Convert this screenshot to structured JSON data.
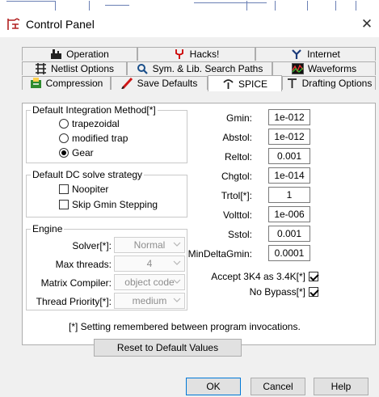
{
  "window": {
    "title": "Control Panel",
    "close_glyph": "✕",
    "title_icon": "app-logo-icon"
  },
  "tabs": {
    "row1": [
      {
        "label": "Operation",
        "icon": "operation-icon"
      },
      {
        "label": "Hacks!",
        "icon": "hacks-icon"
      },
      {
        "label": "Internet",
        "icon": "internet-icon"
      }
    ],
    "row2": [
      {
        "label": "Netlist Options",
        "icon": "netlist-icon"
      },
      {
        "label": "Sym. & Lib. Search Paths",
        "icon": "search-icon"
      },
      {
        "label": "Waveforms",
        "icon": "waveforms-icon"
      }
    ],
    "row3": [
      {
        "label": "Compression",
        "icon": "compression-icon"
      },
      {
        "label": "Save Defaults",
        "icon": "save-defaults-icon"
      },
      {
        "label": "SPICE",
        "icon": "spice-icon",
        "active": true
      },
      {
        "label": "Drafting Options",
        "icon": "drafting-icon"
      }
    ]
  },
  "integration": {
    "legend": "Default Integration Method[*]",
    "options": [
      {
        "label": "trapezoidal",
        "selected": false
      },
      {
        "label": "modified trap",
        "selected": false
      },
      {
        "label": "Gear",
        "selected": true
      }
    ]
  },
  "dc_strategy": {
    "legend": "Default DC solve strategy",
    "options": [
      {
        "label": "Noopiter",
        "checked": false
      },
      {
        "label": "Skip Gmin Stepping",
        "checked": false
      }
    ]
  },
  "engine": {
    "legend": "Engine",
    "solver_label": "Solver[*]:",
    "solver_value": "Normal",
    "threads_label": "Max threads:",
    "threads_value": "4",
    "compiler_label": "Matrix Compiler:",
    "compiler_value": "object code",
    "priority_label": "Thread Priority[*]:",
    "priority_value": "medium"
  },
  "params": [
    {
      "label": "Gmin:",
      "value": "1e-012"
    },
    {
      "label": "Abstol:",
      "value": "1e-012"
    },
    {
      "label": "Reltol:",
      "value": "0.001"
    },
    {
      "label": "Chgtol:",
      "value": "1e-014"
    },
    {
      "label": "Trtol[*]:",
      "value": "1"
    },
    {
      "label": "Volttol:",
      "value": "1e-006"
    },
    {
      "label": "Sstol:",
      "value": "0.001"
    },
    {
      "label": "MinDeltaGmin:",
      "value": "0.0001"
    }
  ],
  "options": {
    "accept3k4_label": "Accept 3K4 as 3.4K[*]",
    "accept3k4_checked": true,
    "nobypass_label": "No Bypass[*]",
    "nobypass_checked": true
  },
  "footer_note": "[*] Setting remembered between program invocations.",
  "reset_label": "Reset to Default Values",
  "buttons": {
    "ok": "OK",
    "cancel": "Cancel",
    "help": "Help"
  },
  "colors": {
    "accent": "#0078d7",
    "dialog_bg": "#f0f0f0",
    "panel_bg": "#ffffff"
  }
}
